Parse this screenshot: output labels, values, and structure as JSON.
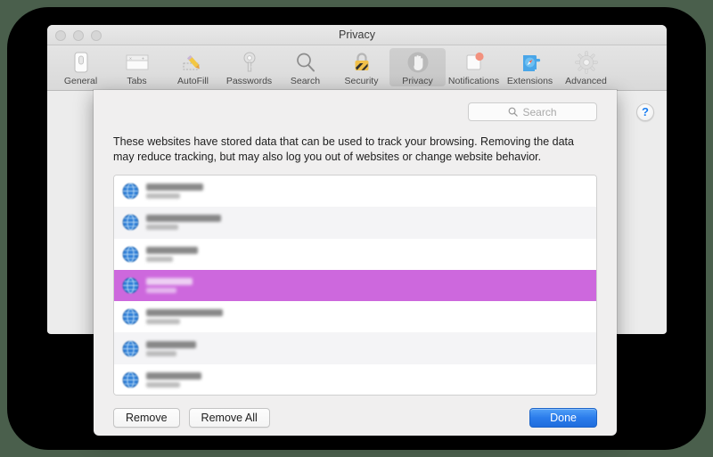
{
  "window": {
    "title": "Privacy",
    "traffic_lights": [
      "close",
      "minimize",
      "zoom"
    ],
    "help_label": "?"
  },
  "toolbar": {
    "items": [
      {
        "label": "General",
        "icon": "general-switch-icon",
        "selected": false
      },
      {
        "label": "Tabs",
        "icon": "tabs-window-icon",
        "selected": false
      },
      {
        "label": "AutoFill",
        "icon": "autofill-pencil-icon",
        "selected": false
      },
      {
        "label": "Passwords",
        "icon": "passwords-key-icon",
        "selected": false
      },
      {
        "label": "Search",
        "icon": "search-magnifier-icon",
        "selected": false
      },
      {
        "label": "Security",
        "icon": "security-padlock-icon",
        "selected": false
      },
      {
        "label": "Privacy",
        "icon": "privacy-hand-icon",
        "selected": true
      },
      {
        "label": "Notifications",
        "icon": "notifications-badge-icon",
        "selected": false
      },
      {
        "label": "Extensions",
        "icon": "extensions-puzzle-icon",
        "selected": false
      },
      {
        "label": "Advanced",
        "icon": "advanced-gear-icon",
        "selected": false
      }
    ]
  },
  "sheet": {
    "search": {
      "value": "",
      "placeholder": "Search",
      "icon": "search-icon"
    },
    "description": "These websites have stored data that can be used to track your browsing. Removing the data may reduce tracking, but may also log you out of websites or change website behavior.",
    "list": {
      "rows": [
        {
          "name": "",
          "detail": "",
          "selected": false,
          "name_width": 64,
          "detail_width": 38,
          "redacted": true
        },
        {
          "name": "",
          "detail": "",
          "selected": false,
          "name_width": 84,
          "detail_width": 36,
          "redacted": true
        },
        {
          "name": "",
          "detail": "",
          "selected": false,
          "name_width": 58,
          "detail_width": 30,
          "redacted": true
        },
        {
          "name": "",
          "detail": "",
          "selected": true,
          "name_width": 52,
          "detail_width": 34,
          "redacted": true
        },
        {
          "name": "",
          "detail": "",
          "selected": false,
          "name_width": 86,
          "detail_width": 38,
          "redacted": true
        },
        {
          "name": "",
          "detail": "",
          "selected": false,
          "name_width": 56,
          "detail_width": 34,
          "redacted": true
        },
        {
          "name": "",
          "detail": "",
          "selected": false,
          "name_width": 62,
          "detail_width": 38,
          "redacted": true
        }
      ],
      "selection_color": "#cd68dd"
    },
    "buttons": {
      "remove": "Remove",
      "remove_all": "Remove All",
      "done": "Done"
    }
  },
  "colors": {
    "selection": "#cd68dd",
    "default_button": "#2b7ceb",
    "backdrop": "#4a5f4c"
  }
}
